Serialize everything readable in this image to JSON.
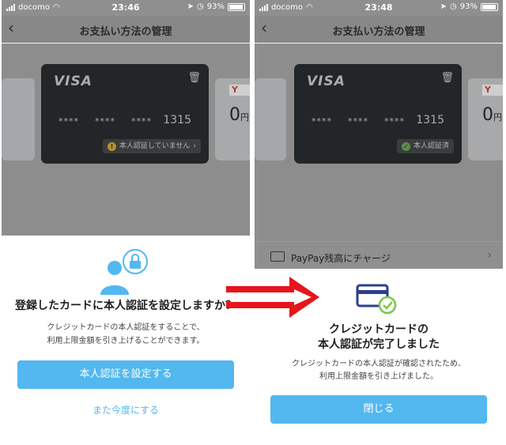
{
  "colors": {
    "accent": "#52b8ef",
    "arrow": "#e8141b",
    "overlay": "#8d8d8d",
    "card": "#232628"
  },
  "left": {
    "status": {
      "carrier": "docomo",
      "time": "23:46",
      "battery": "93%"
    },
    "nav": {
      "back_icon": "chevron-left-icon",
      "title": "お支払い方法の管理"
    },
    "card": {
      "brand": "VISA",
      "mask": [
        "****",
        "****",
        "****"
      ],
      "last4": "1315",
      "badge": "本人認証していません",
      "badge_chevron": "›"
    },
    "peek": {
      "logo": "Y",
      "amount": "0",
      "unit": "円"
    },
    "sheet": {
      "icon": "user-lock-icon",
      "heading": "登録したカードに本人認証を設定しますか？",
      "desc_line1": "クレジットカードの本人認証をすることで、",
      "desc_line2": "利用上限金額を引き上げることができます。",
      "primary_label": "本人認証を設定する",
      "secondary_label": "また今度にする"
    }
  },
  "right": {
    "status": {
      "carrier": "docomo",
      "time": "23:48",
      "battery": "93%"
    },
    "nav": {
      "back_icon": "chevron-left-icon",
      "title": "お支払い方法の管理"
    },
    "card": {
      "brand": "VISA",
      "mask": [
        "****",
        "****",
        "****"
      ],
      "last4": "1315",
      "badge": "本人認証済"
    },
    "peek": {
      "logo": "Y",
      "amount": "0",
      "unit": "円"
    },
    "charge_row": {
      "label": "PayPay残高にチャージ",
      "chevron": "›"
    },
    "sheet": {
      "icon": "card-check-icon",
      "heading_line1": "クレジットカードの",
      "heading_line2": "本人認証が完了しました",
      "desc_line1": "クレジットカードの本人認証が確認されたため、",
      "desc_line2": "利用上限金額を引き上げました。",
      "primary_label": "閉じる"
    }
  }
}
